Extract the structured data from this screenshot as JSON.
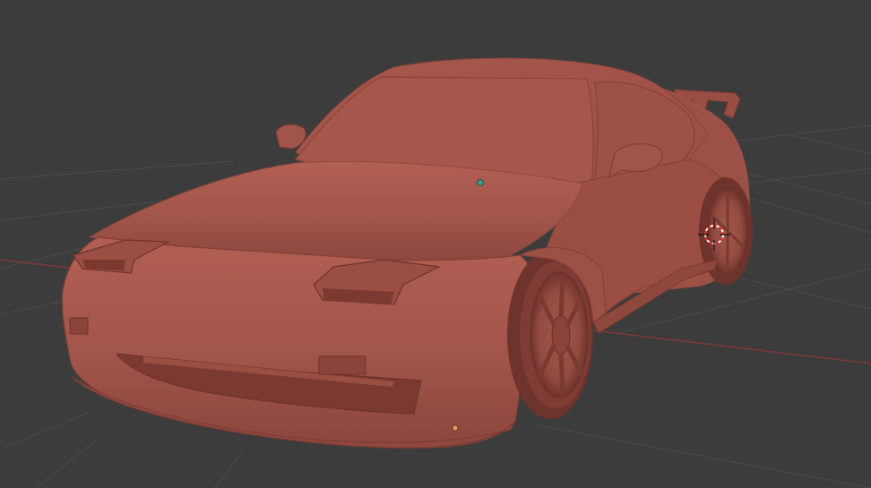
{
  "viewport": {
    "background_color": "#3c3c3c",
    "grid_color": "#4b4b4b",
    "x_axis_color": "#8a3a3a",
    "model_color": "#a2554b",
    "model_shadow_color": "#7a3a32",
    "model_highlight_color": "#bb6a5e",
    "selected_vertex_color": "#3fa08a",
    "origin_point_color": "#e0a060",
    "cursor_colors": [
      "#e03030",
      "#ffffff",
      "#111111"
    ],
    "icons": [
      "3d-cursor-icon",
      "object-origin-icon"
    ]
  }
}
